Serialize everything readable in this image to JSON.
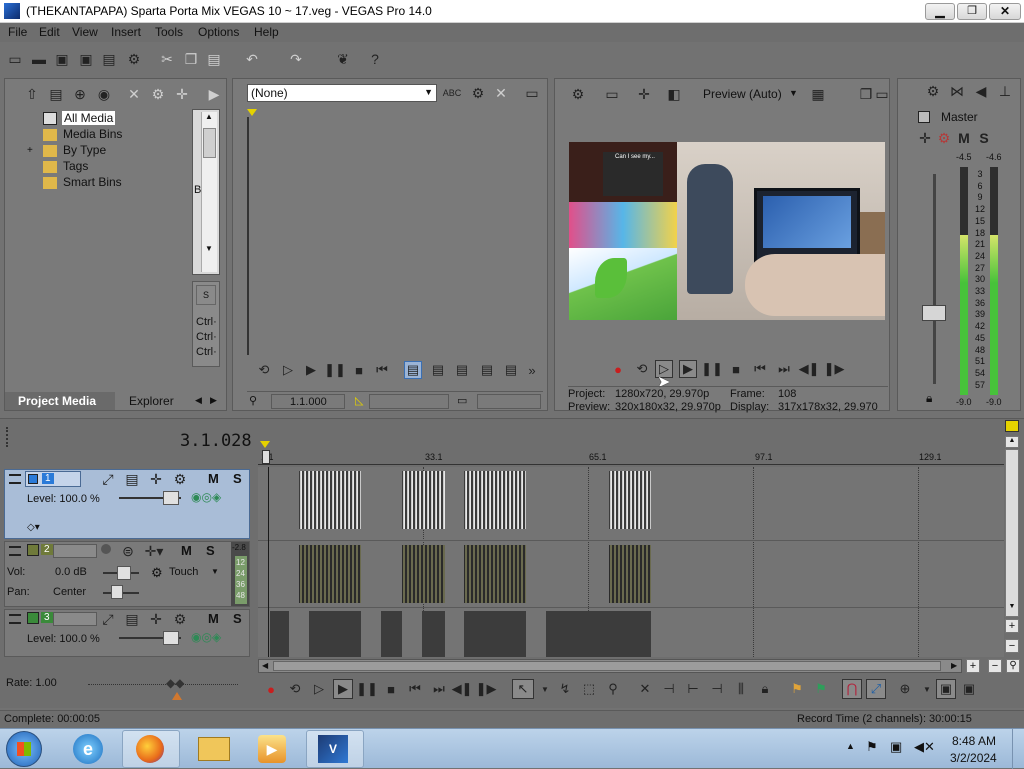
{
  "window": {
    "title": "(THEKANTAPAPA) Sparta Porta Mix VEGAS 10 ~ 17.veg - VEGAS Pro 14.0"
  },
  "menu": [
    "File",
    "Edit",
    "View",
    "Insert",
    "Tools",
    "Options",
    "Help"
  ],
  "project_media": {
    "tree": [
      "All Media",
      "Media Bins",
      "By Type",
      "Tags",
      "Smart Bins"
    ],
    "tabs": [
      "Project Media",
      "Explorer"
    ],
    "side_letter": "B",
    "side_lines": [
      "Ctrl·",
      "Ctrl·",
      "Ctrl·"
    ]
  },
  "trimmer": {
    "dropdown": "(None)",
    "timecode": "1.1.000"
  },
  "preview": {
    "quality": "Preview (Auto)",
    "project_label": "Project:",
    "project_val": "1280x720, 29.970p",
    "preview_label": "Preview:",
    "preview_val": "320x180x32, 29.970p",
    "frame_label": "Frame:",
    "frame_val": "108",
    "display_label": "Display:",
    "display_val": "317x178x32, 29.970",
    "overlay_text": "Can I see my..."
  },
  "master": {
    "label": "Master",
    "top_left": "-4.5",
    "top_right": "-4.6",
    "scale": [
      "3",
      "6",
      "9",
      "12",
      "15",
      "18",
      "21",
      "24",
      "27",
      "30",
      "33",
      "36",
      "39",
      "42",
      "45",
      "48",
      "51",
      "54",
      "57"
    ],
    "bottom_left": "-9.0",
    "bottom_right": "-9.0",
    "level_left": 0.7,
    "level_right": 0.7
  },
  "timeline": {
    "position": "3.1.028",
    "ruler": [
      "1.1",
      "33.1",
      "65.1",
      "97.1",
      "129.1"
    ],
    "tracks": [
      {
        "num": "1",
        "level_label": "Level: 100.0 %"
      },
      {
        "num": "2",
        "vol_label": "Vol:",
        "vol_val": "0.0 dB",
        "pan_label": "Pan:",
        "pan_val": "Center",
        "mode": "Touch",
        "meter": [
          "-2.8",
          "12",
          "24",
          "36",
          "48"
        ]
      },
      {
        "num": "3",
        "level_label": "Level: 100.0 %"
      }
    ],
    "rate": "Rate: 1.00"
  },
  "status": {
    "complete": "Complete: 00:00:05",
    "record": "Record Time (2 channels): 30:00:15"
  },
  "taskbar": {
    "time": "8:48 AM",
    "date": "3/2/2024"
  },
  "colors": {
    "accent": "#1f6fc5",
    "window_bg": "#727272",
    "meter_green": "#47c23a"
  }
}
